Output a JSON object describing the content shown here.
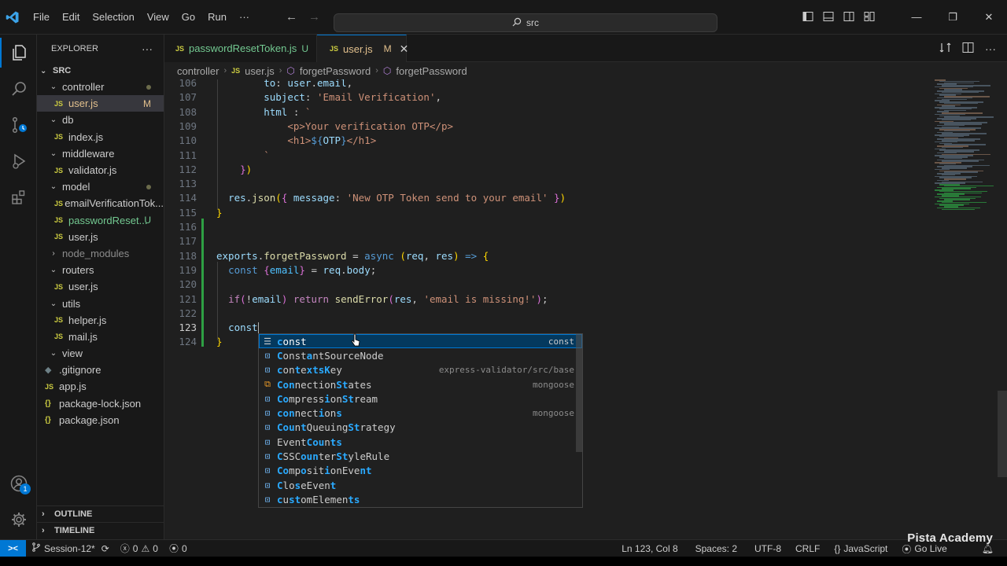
{
  "titlebar": {
    "menu": [
      "File",
      "Edit",
      "Selection",
      "View",
      "Go",
      "Run",
      "···"
    ],
    "search_text": "src"
  },
  "sidebar": {
    "title": "EXPLORER",
    "more": "···",
    "root": "SRC",
    "items": [
      {
        "type": "folder",
        "label": "controller",
        "indent": 1,
        "open": true,
        "decoration": "dot"
      },
      {
        "type": "file",
        "label": "user.js",
        "indent": 2,
        "status": "M",
        "selected": true,
        "state": "modified"
      },
      {
        "type": "folder",
        "label": "db",
        "indent": 1,
        "open": true
      },
      {
        "type": "file",
        "label": "index.js",
        "indent": 2
      },
      {
        "type": "folder",
        "label": "middleware",
        "indent": 1,
        "open": true
      },
      {
        "type": "file",
        "label": "validator.js",
        "indent": 2
      },
      {
        "type": "folder",
        "label": "model",
        "indent": 1,
        "open": true,
        "decoration": "dot"
      },
      {
        "type": "file",
        "label": "emailVerificationTok...",
        "indent": 2
      },
      {
        "type": "file",
        "label": "passwordReset...",
        "indent": 2,
        "status": "U",
        "state": "untracked"
      },
      {
        "type": "file",
        "label": "user.js",
        "indent": 2
      },
      {
        "type": "folder",
        "label": "node_modules",
        "indent": 1,
        "open": false,
        "state": "ignored"
      },
      {
        "type": "folder",
        "label": "routers",
        "indent": 1,
        "open": true
      },
      {
        "type": "file",
        "label": "user.js",
        "indent": 2
      },
      {
        "type": "folder",
        "label": "utils",
        "indent": 1,
        "open": true
      },
      {
        "type": "file",
        "label": "helper.js",
        "indent": 2
      },
      {
        "type": "file",
        "label": "mail.js",
        "indent": 2
      },
      {
        "type": "folder",
        "label": "view",
        "indent": 1,
        "open": true
      },
      {
        "type": "gitignore",
        "label": ".gitignore",
        "indent": 1
      },
      {
        "type": "file",
        "label": "app.js",
        "indent": 1
      },
      {
        "type": "json",
        "label": "package-lock.json",
        "indent": 1
      },
      {
        "type": "json",
        "label": "package.json",
        "indent": 1
      }
    ],
    "outline": "OUTLINE",
    "timeline": "TIMELINE"
  },
  "tabs": [
    {
      "label": "passwordResetToken.js",
      "flag": "U",
      "active": false
    },
    {
      "label": "user.js",
      "flag": "M",
      "active": true,
      "close": "✕"
    }
  ],
  "breadcrumb": [
    "controller",
    "user.js",
    "forgetPassword",
    "forgetPassword"
  ],
  "editor": {
    "lines": [
      {
        "n": "106",
        "tokens": [
          [
            "t",
            "        "
          ],
          [
            "v",
            "to"
          ],
          [
            "t",
            ": "
          ],
          [
            "v",
            "user"
          ],
          [
            "t",
            "."
          ],
          [
            "v",
            "email"
          ],
          [
            "t",
            ","
          ]
        ]
      },
      {
        "n": "107",
        "tokens": [
          [
            "t",
            "        "
          ],
          [
            "v",
            "subject"
          ],
          [
            "t",
            ": "
          ],
          [
            "s",
            "'Email Verification'"
          ],
          [
            "t",
            ","
          ]
        ]
      },
      {
        "n": "108",
        "tokens": [
          [
            "t",
            "        "
          ],
          [
            "v",
            "html"
          ],
          [
            "t",
            " : "
          ],
          [
            "s",
            "`"
          ]
        ]
      },
      {
        "n": "109",
        "tokens": [
          [
            "t",
            "            "
          ],
          [
            "s",
            "<p>Your verification OTP</p>"
          ]
        ]
      },
      {
        "n": "110",
        "tokens": [
          [
            "t",
            "            "
          ],
          [
            "s",
            "<h1>"
          ],
          [
            "k",
            "${"
          ],
          [
            "v",
            "OTP"
          ],
          [
            "k",
            "}"
          ],
          [
            "s",
            "</h1>"
          ]
        ]
      },
      {
        "n": "111",
        "tokens": [
          [
            "t",
            "        "
          ],
          [
            "s",
            "`"
          ]
        ]
      },
      {
        "n": "112",
        "tokens": [
          [
            "t",
            "    "
          ],
          [
            "b2",
            "}"
          ],
          [
            "b1",
            ")"
          ]
        ]
      },
      {
        "n": "113",
        "tokens": []
      },
      {
        "n": "114",
        "tokens": [
          [
            "t",
            "  "
          ],
          [
            "v",
            "res"
          ],
          [
            "t",
            "."
          ],
          [
            "f",
            "json"
          ],
          [
            "b1",
            "("
          ],
          [
            "b2",
            "{"
          ],
          [
            "t",
            " "
          ],
          [
            "v",
            "message"
          ],
          [
            "t",
            ": "
          ],
          [
            "s",
            "'New OTP Token send to your email'"
          ],
          [
            "t",
            " "
          ],
          [
            "b2",
            "}"
          ],
          [
            "b1",
            ")"
          ]
        ]
      },
      {
        "n": "115",
        "tokens": [
          [
            "b1",
            "}"
          ]
        ]
      },
      {
        "n": "116",
        "tokens": []
      },
      {
        "n": "117",
        "tokens": []
      },
      {
        "n": "118",
        "tokens": [
          [
            "v",
            "exports"
          ],
          [
            "t",
            "."
          ],
          [
            "f",
            "forgetPassword"
          ],
          [
            "t",
            " = "
          ],
          [
            "k",
            "async"
          ],
          [
            "t",
            " "
          ],
          [
            "b1",
            "("
          ],
          [
            "v",
            "req"
          ],
          [
            "t",
            ", "
          ],
          [
            "v",
            "res"
          ],
          [
            "b1",
            ")"
          ],
          [
            "t",
            " "
          ],
          [
            "k",
            "=>"
          ],
          [
            "t",
            " "
          ],
          [
            "b1",
            "{"
          ]
        ]
      },
      {
        "n": "119",
        "tokens": [
          [
            "t",
            "  "
          ],
          [
            "k",
            "const"
          ],
          [
            "t",
            " "
          ],
          [
            "b2",
            "{"
          ],
          [
            "c",
            "email"
          ],
          [
            "b2",
            "}"
          ],
          [
            "t",
            " = "
          ],
          [
            "v",
            "req"
          ],
          [
            "t",
            "."
          ],
          [
            "v",
            "body"
          ],
          [
            "t",
            ";"
          ]
        ]
      },
      {
        "n": "120",
        "tokens": []
      },
      {
        "n": "121",
        "tokens": [
          [
            "t",
            "  "
          ],
          [
            "x",
            "if"
          ],
          [
            "b2",
            "("
          ],
          [
            "t",
            "!"
          ],
          [
            "v",
            "email"
          ],
          [
            "b2",
            ")"
          ],
          [
            "t",
            " "
          ],
          [
            "x",
            "return"
          ],
          [
            "t",
            " "
          ],
          [
            "f",
            "sendError"
          ],
          [
            "b2",
            "("
          ],
          [
            "v",
            "res"
          ],
          [
            "t",
            ", "
          ],
          [
            "s",
            "'email is missing!'"
          ],
          [
            "b2",
            ")"
          ],
          [
            "t",
            ";"
          ]
        ]
      },
      {
        "n": "122",
        "tokens": []
      },
      {
        "n": "123",
        "tokens": [
          [
            "t",
            "  "
          ],
          [
            "v",
            "const"
          ]
        ],
        "current": true
      },
      {
        "n": "124",
        "tokens": [
          [
            "b1",
            "}"
          ]
        ]
      }
    ]
  },
  "suggest": [
    {
      "icon": "keyword",
      "label": "const",
      "hl": [
        0,
        5
      ],
      "detail": "const",
      "selected": true
    },
    {
      "icon": "variable",
      "label": "ConstantSourceNode",
      "hl": [
        0,
        5
      ],
      "detail": ""
    },
    {
      "icon": "variable",
      "label": "contextsKey",
      "hl": [
        0,
        3,
        5,
        6,
        7,
        8
      ],
      "detail": "express-validator/src/base"
    },
    {
      "icon": "enum",
      "label": "ConnectionStates",
      "hl": [
        0,
        1,
        2,
        10,
        11
      ],
      "detail": "mongoose"
    },
    {
      "icon": "variable",
      "label": "CompressionStream",
      "hl": [
        0,
        1,
        8,
        11,
        12
      ],
      "detail": ""
    },
    {
      "icon": "variable",
      "label": "connections",
      "hl": [
        0,
        1,
        2,
        7,
        10
      ],
      "detail": "mongoose"
    },
    {
      "icon": "variable",
      "label": "CountQueuingStrategy",
      "hl": [
        0,
        1,
        2,
        4,
        12,
        13
      ],
      "detail": ""
    },
    {
      "icon": "variable",
      "label": "EventCounts",
      "hl": [
        5,
        6,
        7,
        9,
        10
      ],
      "detail": ""
    },
    {
      "icon": "variable",
      "label": "CSSCounterStyleRule",
      "hl": [
        0,
        4,
        5,
        6,
        10,
        11
      ],
      "detail": ""
    },
    {
      "icon": "variable",
      "label": "CompositionEvent",
      "hl": [
        0,
        1,
        4,
        8,
        14,
        15
      ],
      "detail": ""
    },
    {
      "icon": "variable",
      "label": "CloseEvent",
      "hl": [
        0,
        3,
        9
      ],
      "detail": ""
    },
    {
      "icon": "variable",
      "label": "customElements",
      "hl": [
        0,
        2,
        3,
        12,
        13
      ],
      "detail": ""
    }
  ],
  "statusbar": {
    "remote_icon": "><",
    "branch": "Session-12*",
    "sync": "⟳",
    "errors": "0",
    "warnings": "0",
    "ports": "0",
    "position": "Ln 123, Col 8",
    "spaces": "Spaces: 2",
    "encoding": "UTF-8",
    "eol": "CRLF",
    "language": "JavaScript",
    "golive": "Go Live",
    "watermark": "Pista Academy"
  },
  "activity": {
    "accounts_badge": "1"
  },
  "colors": {
    "accent": "#0078d4",
    "modified": "#e2c08d",
    "untracked": "#73c991",
    "git_added": "#2ea043"
  }
}
